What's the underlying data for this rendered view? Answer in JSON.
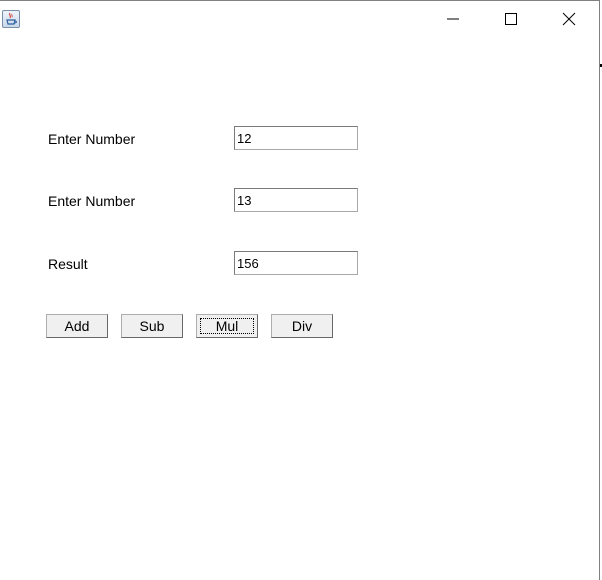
{
  "window": {
    "icon": "java-cup-icon",
    "controls": [
      "minimize-icon",
      "maximize-icon",
      "close-icon"
    ]
  },
  "form": {
    "label1": "Enter Number",
    "value1": "12",
    "label2": "Enter Number",
    "value2": "13",
    "label3": "Result",
    "value3": "156"
  },
  "buttons": {
    "add": "Add",
    "sub": "Sub",
    "mul": "Mul",
    "div": "Div"
  }
}
